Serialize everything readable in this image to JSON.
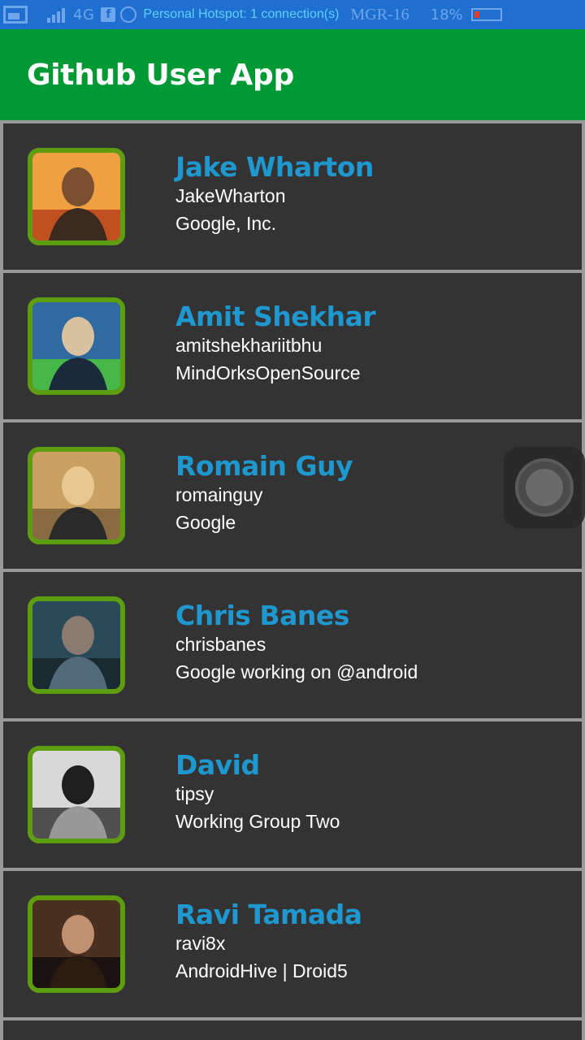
{
  "status_bar": {
    "network": "4G",
    "hotspot_text": "Personal Hotspot: 1 connection(s)",
    "carrier": "MGR-16",
    "battery_percent": "18%",
    "facebook_glyph": "f"
  },
  "app_bar": {
    "title": "Github User App"
  },
  "colors": {
    "app_bar": "#009933",
    "status_bar": "#1f6fd0",
    "card_bg": "#333333",
    "name": "#1f97cf",
    "avatar_border": "#5e9d10"
  },
  "users": [
    {
      "name": "Jake Wharton",
      "login": "JakeWharton",
      "company": "Google, Inc."
    },
    {
      "name": "Amit Shekhar",
      "login": "amitshekhariitbhu",
      "company": "MindOrksOpenSource"
    },
    {
      "name": "Romain Guy",
      "login": "romainguy",
      "company": "Google"
    },
    {
      "name": "Chris Banes",
      "login": "chrisbanes",
      "company": "Google working on @android"
    },
    {
      "name": "David",
      "login": "tipsy",
      "company": "Working Group Two"
    },
    {
      "name": "Ravi Tamada",
      "login": "ravi8x",
      "company": "AndroidHive | Droid5"
    }
  ]
}
